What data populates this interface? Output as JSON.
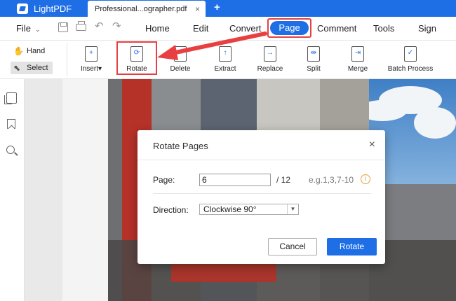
{
  "app": {
    "name": "LightPDF"
  },
  "tabs": [
    {
      "label": "Professional...ographer.pdf",
      "close": "×"
    }
  ],
  "new_tab": "+",
  "menu": {
    "file": "File",
    "file_chevron": "⌄",
    "items": [
      "Home",
      "Edit",
      "Convert",
      "Page",
      "Comment",
      "Tools",
      "Sign"
    ],
    "active": "Page"
  },
  "quick_icons": [
    "save-icon",
    "print-icon",
    "undo-icon",
    "redo-icon"
  ],
  "modes": {
    "hand": "Hand",
    "select": "Select",
    "active": "Select"
  },
  "toolbar": {
    "insert": "Insert",
    "rotate": "Rotate",
    "delete": "Delete",
    "extract": "Extract",
    "replace": "Replace",
    "split": "Split",
    "merge": "Merge",
    "batch": "Batch Process"
  },
  "sidebar": [
    "pages-icon",
    "bookmark-icon",
    "search-icon"
  ],
  "dialog": {
    "title": "Rotate Pages",
    "close": "×",
    "page_label": "Page:",
    "page_value": "6",
    "total": "/ 12",
    "hint": "e.g.1,3,7-10",
    "info": "i",
    "direction_label": "Direction:",
    "direction_value": "Clockwise 90°",
    "cancel": "Cancel",
    "confirm": "Rotate"
  },
  "colors": {
    "accent": "#1e6fe6",
    "highlight": "#e84040"
  }
}
